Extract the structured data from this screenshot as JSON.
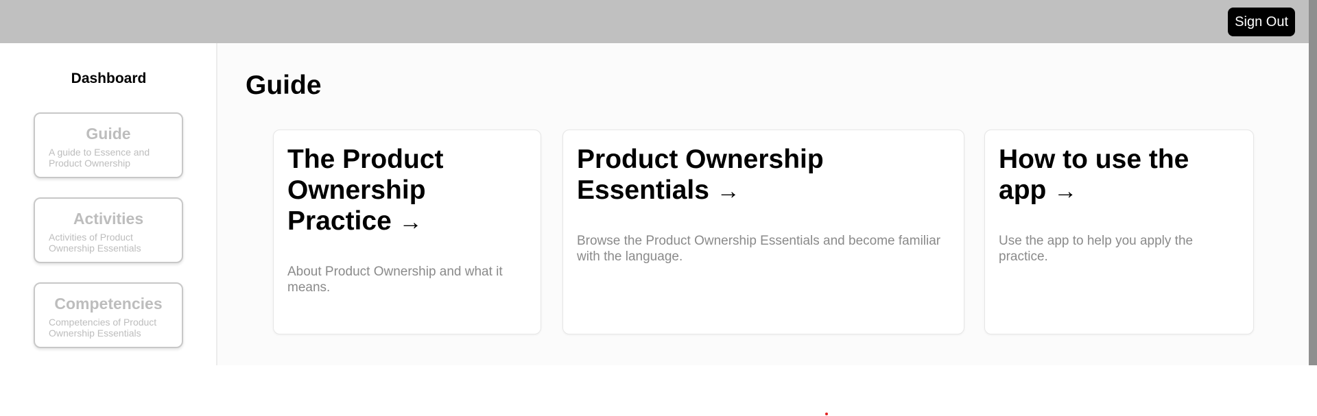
{
  "header": {
    "sign_out_label": "Sign Out"
  },
  "sidebar": {
    "title": "Dashboard",
    "items": [
      {
        "title": "Guide",
        "description": "A guide to Essence and Product Ownership"
      },
      {
        "title": "Activities",
        "description": "Activities of Product Ownership Essentials"
      },
      {
        "title": "Competencies",
        "description": "Competencies of Product Ownership Essentials"
      }
    ]
  },
  "main": {
    "title": "Guide",
    "cards": [
      {
        "title": "The Product Ownership Practice",
        "description": "About Product Ownership and what it means."
      },
      {
        "title": "Product Ownership Essentials",
        "description": "Browse the Product Ownership Essentials and become familiar with the language."
      },
      {
        "title": "How to use the app",
        "description": "Use the app to help you apply the practice."
      }
    ],
    "arrow_glyph": "→"
  },
  "colors": {
    "topbar": "#c0c0c0",
    "button": "#000000",
    "muted_text": "#bdbdbd",
    "description_text": "#8a8a8a"
  }
}
